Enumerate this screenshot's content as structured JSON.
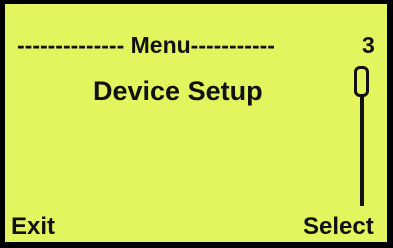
{
  "lcd": {
    "header": "-------------- Menu-----------",
    "page_number": "3",
    "menu_item": "Device Setup",
    "softkeys": {
      "left": "Exit",
      "right": "Select"
    },
    "scroll_position": 0
  },
  "colors": {
    "screen_background": "#e2f45e",
    "text": "#111111",
    "bezel": "#000000"
  }
}
